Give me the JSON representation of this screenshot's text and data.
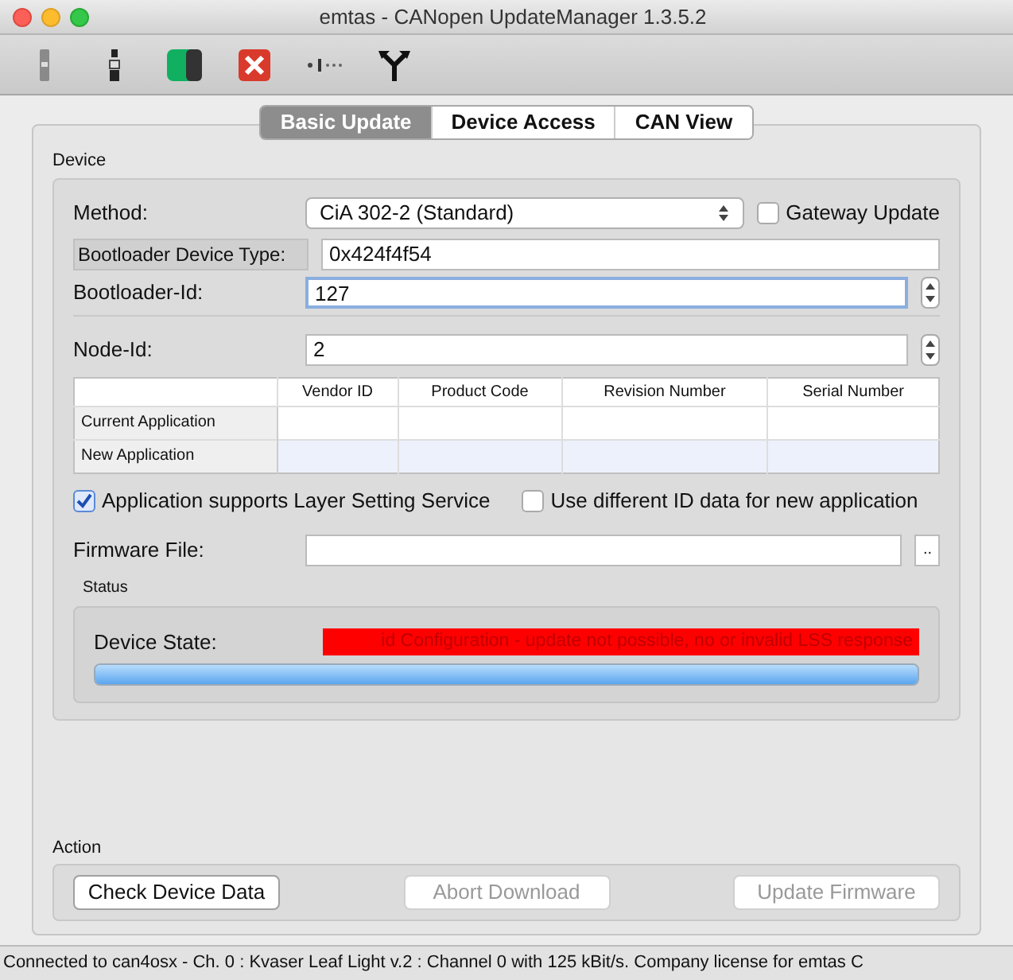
{
  "window": {
    "title": "emtas - CANopen UpdateManager 1.3.5.2"
  },
  "toolbar": [
    {
      "kind": "plug"
    },
    {
      "kind": "plug-dark"
    },
    {
      "kind": "app"
    },
    {
      "kind": "stop"
    },
    {
      "kind": "signal"
    },
    {
      "kind": "fork"
    }
  ],
  "tabs": [
    {
      "label": "Basic Update",
      "selected": true
    },
    {
      "label": "Device Access",
      "selected": false
    },
    {
      "label": "CAN View",
      "selected": false
    }
  ],
  "device": {
    "title": "Device",
    "method": {
      "label": "Method:",
      "value": "CiA 302-2 (Standard)"
    },
    "gateway": {
      "label": "Gateway Update",
      "checked": false
    },
    "device_type": {
      "label": "Bootloader Device Type:",
      "value": "0x424f4f54"
    },
    "bootloader_id": {
      "label": "Bootloader-Id:",
      "value": "127"
    },
    "node_id": {
      "label": "Node-Id:",
      "value": "2"
    },
    "table": {
      "columns": [
        "Vendor ID",
        "Product Code",
        "Revision Number",
        "Serial Number"
      ],
      "rows": [
        {
          "label": "Current Application",
          "selected": false
        },
        {
          "label": "New Application",
          "selected": true
        }
      ]
    },
    "options": [
      {
        "label": "Application supports Layer Setting Service",
        "checked": true
      },
      {
        "label": "Use different ID data for new application",
        "checked": false
      }
    ],
    "firmware": {
      "label": "Firmware File:",
      "browse": ".."
    }
  },
  "status": {
    "title": "Status",
    "label": "Device State:",
    "value": "id Configuration - update not possible, no or invalid LSS response",
    "level": 1
  },
  "action": {
    "title": "Action",
    "buttons": [
      {
        "label": "Check Device Data",
        "disabled": false
      },
      {
        "label": "Abort Download",
        "disabled": true
      },
      {
        "label": "Update Firmware",
        "disabled": true
      }
    ]
  },
  "status_bar": "Connected to can4osx - Ch. 0 : Kvaser Leaf Light v.2 : Channel 0 with 125 kBit/s.  Company license for emtas C"
}
